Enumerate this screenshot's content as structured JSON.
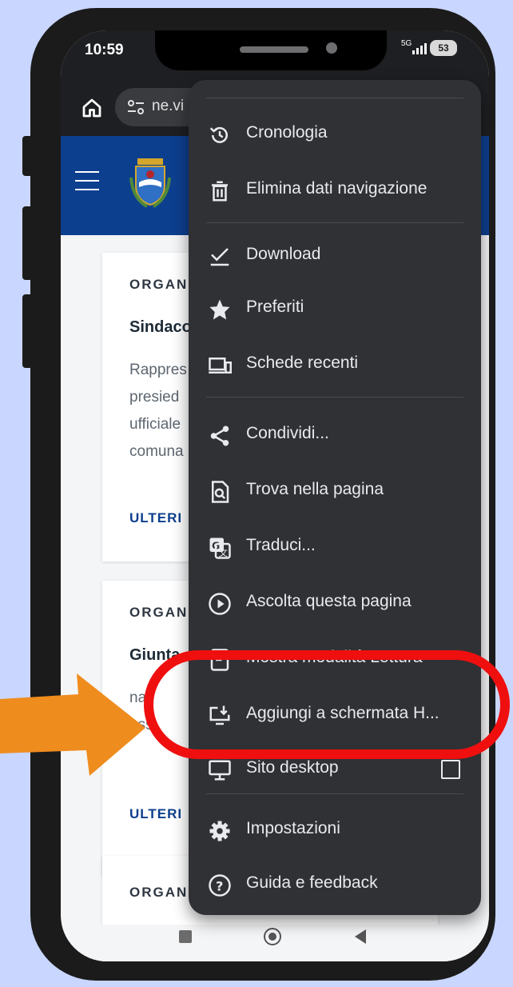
{
  "status": {
    "time": "10:59",
    "network": "5G",
    "battery": "53"
  },
  "browser": {
    "url_fragment": "ne.vi"
  },
  "cards": [
    {
      "tag": "ORGAN",
      "title": "Sindaco",
      "desc": [
        "Rappres",
        "presied",
        "ufficiale",
        "comuna"
      ],
      "more": "ULTERI"
    },
    {
      "tag": "ORGAN",
      "title": "Giunta",
      "desc": [
        "nat",
        "ass"
      ],
      "more": "ULTERI"
    },
    {
      "tag": "ORGAN"
    }
  ],
  "menu": {
    "items": [
      {
        "label": "Cronologia",
        "icon": "history-icon"
      },
      {
        "label": "Elimina dati navigazione",
        "icon": "trash-icon"
      },
      {
        "label": "Download",
        "icon": "download-check-icon"
      },
      {
        "label": "Preferiti",
        "icon": "star-icon"
      },
      {
        "label": "Schede recenti",
        "icon": "devices-icon"
      },
      {
        "label": "Condividi...",
        "icon": "share-icon"
      },
      {
        "label": "Trova nella pagina",
        "icon": "find-in-page-icon"
      },
      {
        "label": "Traduci...",
        "icon": "translate-icon"
      },
      {
        "label": "Ascolta questa pagina",
        "icon": "play-circle-icon"
      },
      {
        "label": "Mostra modalità Lettura",
        "icon": "reader-icon"
      },
      {
        "label": "Aggiungi a schermata H...",
        "icon": "add-to-home-icon"
      },
      {
        "label": "Sito desktop",
        "icon": "desktop-icon"
      },
      {
        "label": "Impostazioni",
        "icon": "gear-icon"
      },
      {
        "label": "Guida e feedback",
        "icon": "help-icon"
      }
    ]
  },
  "colors": {
    "highlight": "#ef0f0f",
    "arrow": "#ef8c1e",
    "header": "#0d3f8f",
    "menu": "#303134"
  }
}
